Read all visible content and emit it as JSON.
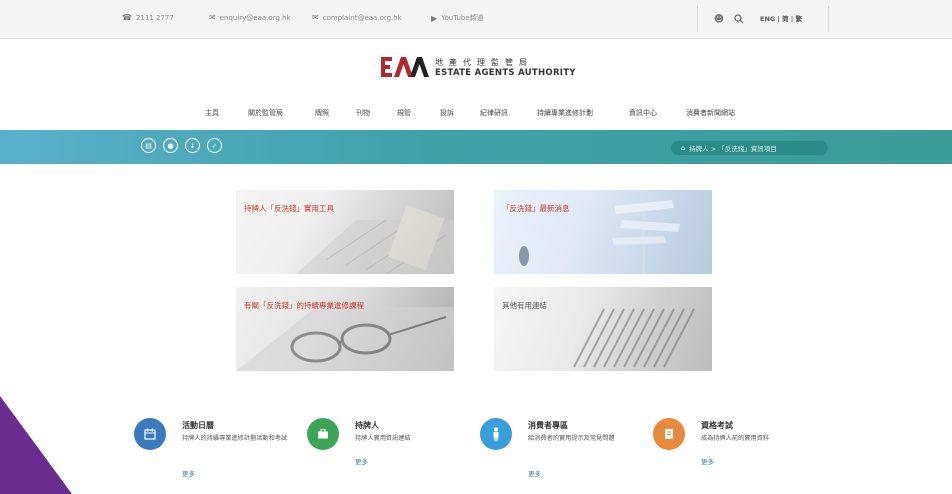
{
  "topbar": {
    "phone": "2111 2777",
    "enquiry_email": "enquiry@eaa.org.hk",
    "complaint_email": "complaint@eaa.org.hk",
    "youtube": "YouTube頻道",
    "lang": "ENG | 简 | 繁",
    "icons": [
      "phone-icon",
      "mail-icon",
      "mail-icon",
      "youtube-icon",
      "user-icon",
      "search-icon"
    ]
  },
  "logo": {
    "mark": "EAA",
    "zh": "地產代理監管局",
    "en": "ESTATE AGENTS AUTHORITY",
    "brand_color": "#b0282e"
  },
  "nav": {
    "items": [
      "主頁",
      "關於監管局",
      "牌照",
      "刊物",
      "規管",
      "投訴",
      "紀律研訊",
      "持續專業進修計劃",
      "資訊中心",
      "消費者新聞網站"
    ]
  },
  "band": {
    "circle_icons": [
      "print-icon",
      "contact-icon",
      "download-icon",
      "share-icon"
    ],
    "breadcrumb_home": "⌂",
    "breadcrumb": "持牌人 > 「反洗錢」資訊項目"
  },
  "tiles": [
    {
      "label": "持牌人「反洗錢」實用工具",
      "label_color": "#c0392b"
    },
    {
      "label": "「反洗錢」最新消息",
      "label_color": "#c0392b"
    },
    {
      "label": "有關「反洗錢」的持續專業進修課程",
      "label_color": "#c0392b"
    },
    {
      "label": "其他有用連結",
      "label_color": "#555555"
    }
  ],
  "quick_links": [
    {
      "title": "活動日曆",
      "desc": "持牌人的持續專業進修計劃活動和考試",
      "more": "更多",
      "color": "#3a7bc0",
      "icon": "calendar-icon"
    },
    {
      "title": "持牌人",
      "desc": "持牌人實用資訊連結",
      "more": "更多",
      "color": "#3aa655",
      "icon": "briefcase-icon"
    },
    {
      "title": "消費者專區",
      "desc": "給消費者的實用提示及常見問題",
      "more": "更多",
      "color": "#3a9fd8",
      "icon": "person-icon"
    },
    {
      "title": "資格考試",
      "desc": "成為持牌人前的實用資料",
      "more": "更多",
      "color": "#e8893b",
      "icon": "book-icon"
    }
  ],
  "accent_color": "#6a2d8f"
}
